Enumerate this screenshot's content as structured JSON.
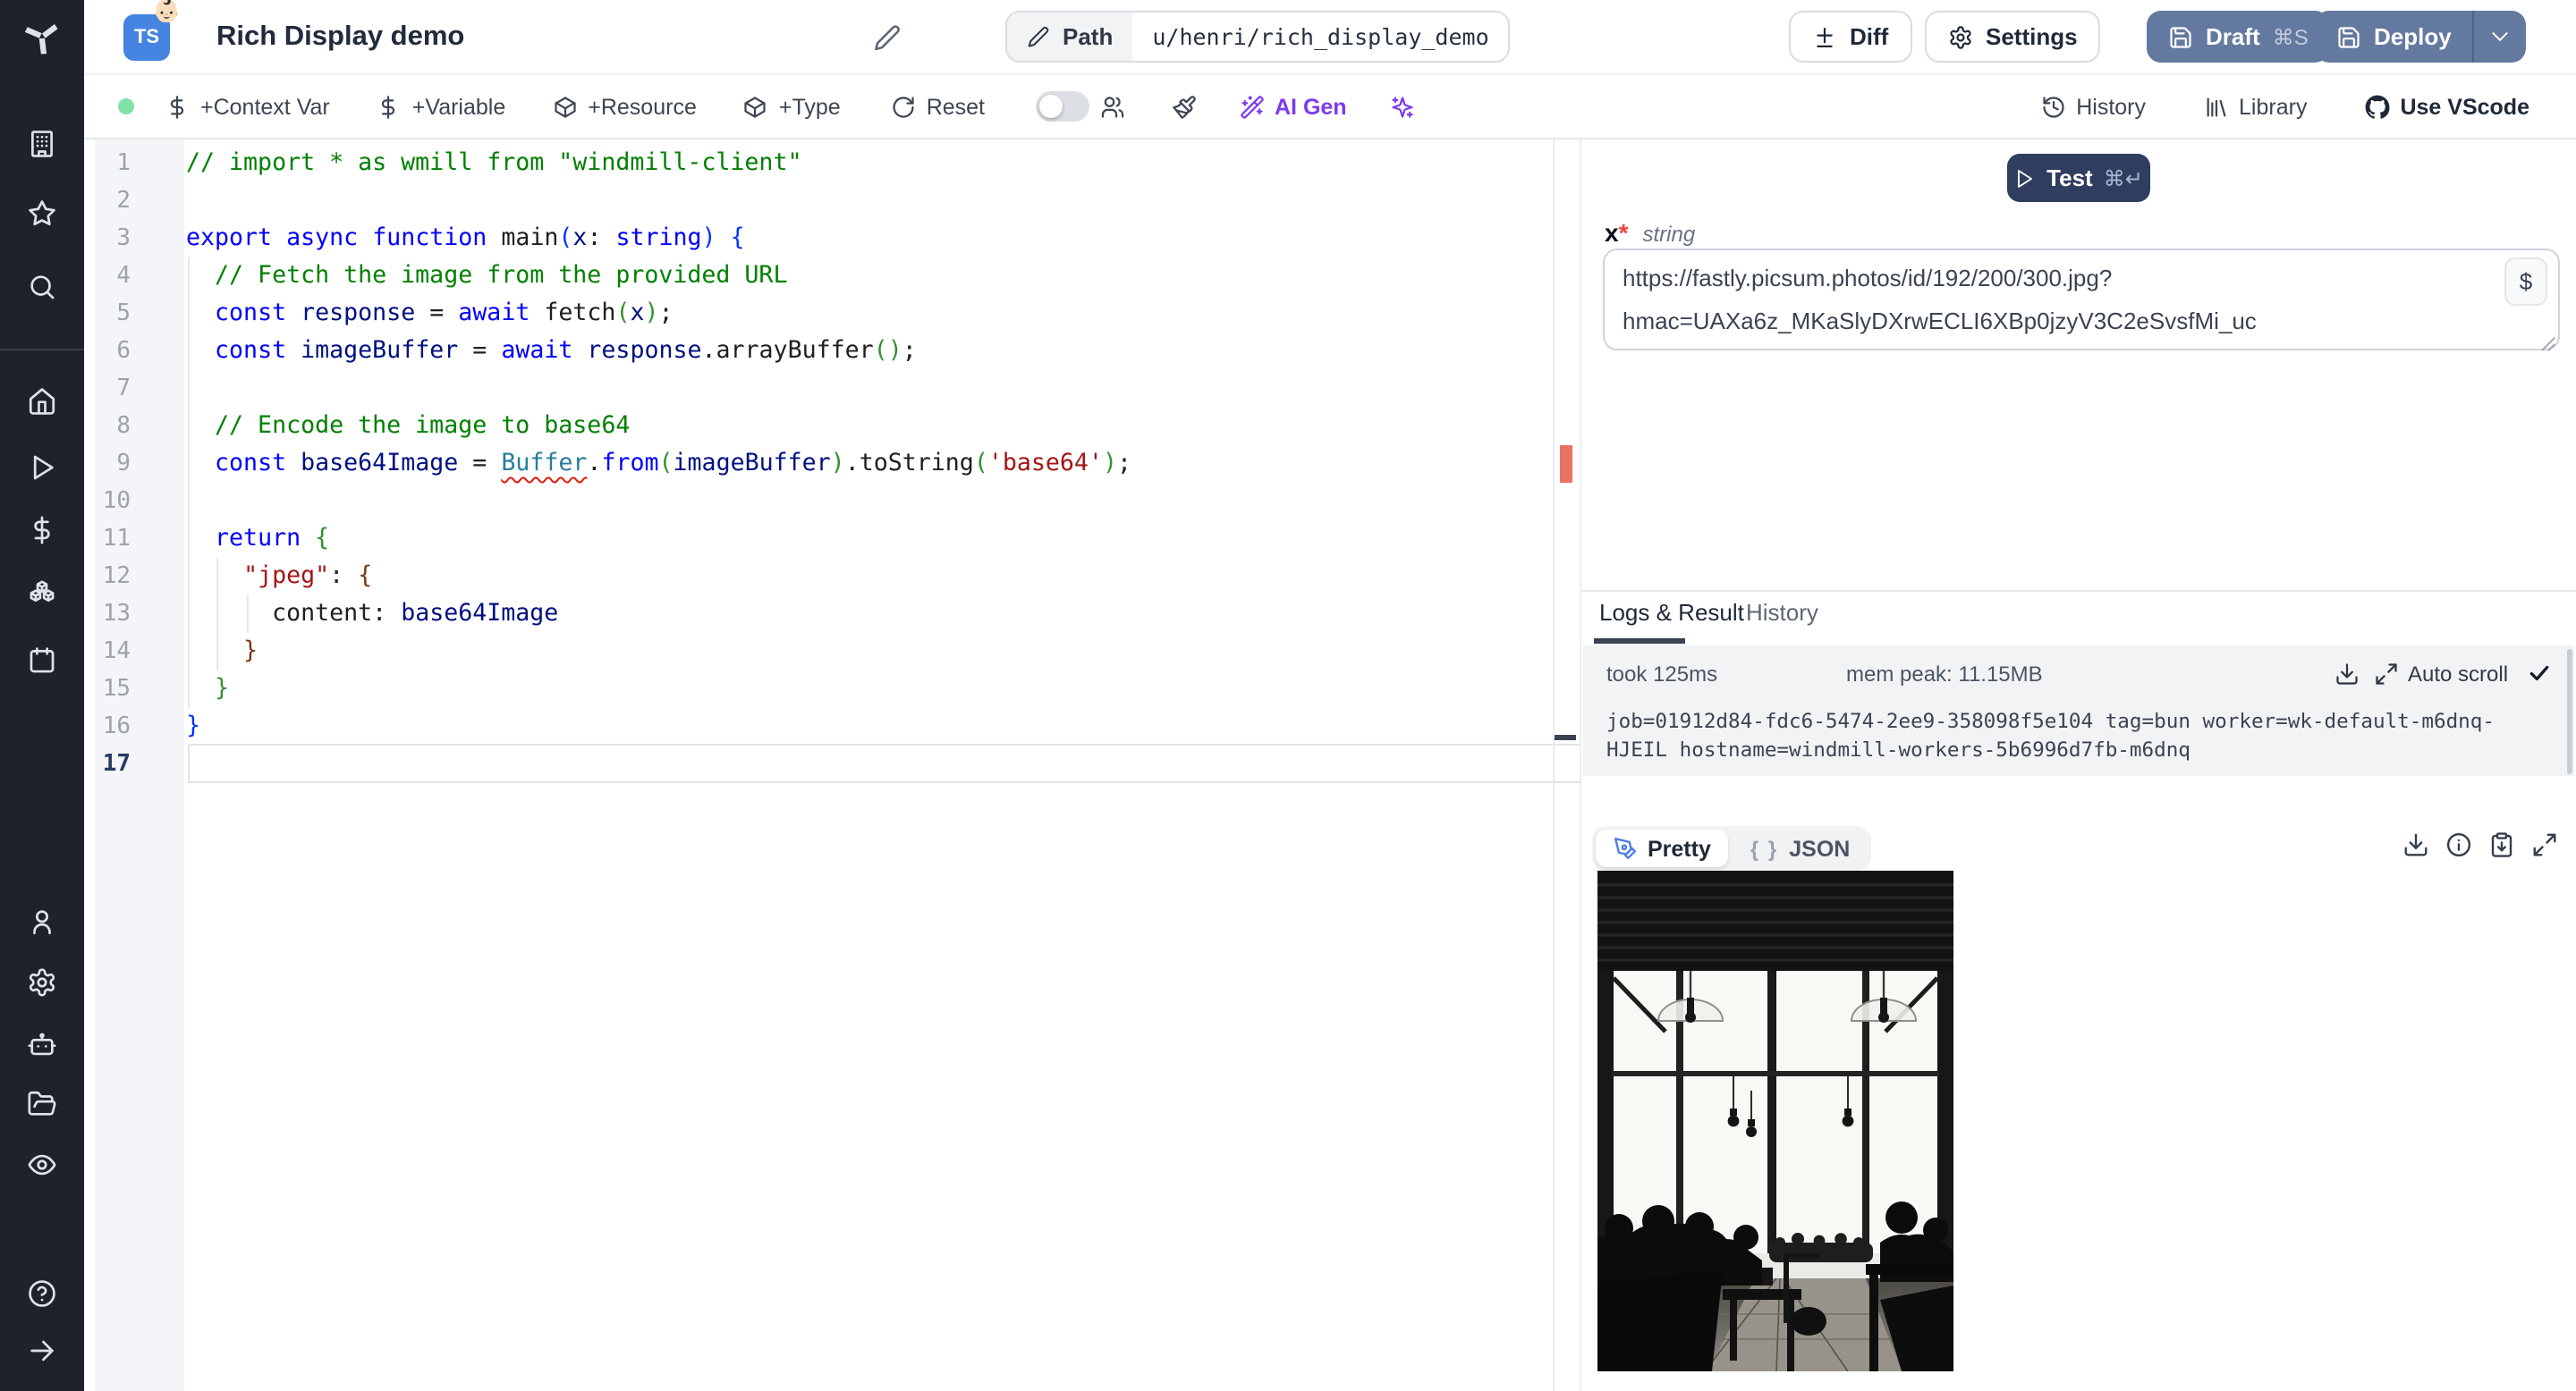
{
  "topbar": {
    "title": "Rich Display demo",
    "lang_badge": "TS",
    "badge_emoji": "👶🏻",
    "path_label": "Path",
    "path_value": "u/henri/rich_display_demo",
    "diff_label": "Diff",
    "settings_label": "Settings",
    "draft_label": "Draft",
    "draft_shortcut": "⌘S",
    "deploy_label": "Deploy"
  },
  "toolbar": {
    "context_var": "+Context Var",
    "variable": "+Variable",
    "resource": "+Resource",
    "type": "+Type",
    "reset": "Reset",
    "ai_gen": "AI Gen",
    "history": "History",
    "library": "Library",
    "vscode": "Use VScode"
  },
  "sidebar": {
    "top": [
      "building",
      "star",
      "search"
    ],
    "middle": [
      "home",
      "play",
      "dollar",
      "boxes",
      "calendar"
    ],
    "lower": [
      "user",
      "gear",
      "bot",
      "folder-open",
      "eye"
    ],
    "footer": [
      "help",
      "arrow-right"
    ]
  },
  "editor": {
    "colors": {
      "c": "#008000",
      "k": "#0000ff",
      "v": "#001080",
      "s": "#a31515",
      "ty": "#267f99",
      "b1": "#0431fa",
      "b2": "#319331",
      "b3": "#7b3814",
      "t": "#1f1f1f"
    },
    "lines": [
      {
        "n": 1,
        "tokens": [
          [
            "// import * as wmill from \"windmill-client\"",
            "c"
          ]
        ]
      },
      {
        "n": 2,
        "tokens": []
      },
      {
        "n": 3,
        "tokens": [
          [
            "export ",
            "k"
          ],
          [
            "async ",
            "k"
          ],
          [
            "function ",
            "k"
          ],
          [
            "main",
            "t"
          ],
          [
            "(",
            "b1"
          ],
          [
            "x",
            "v"
          ],
          [
            ": ",
            "t"
          ],
          [
            "string",
            "k"
          ],
          [
            ") ",
            "b1"
          ],
          [
            "{",
            "b1"
          ]
        ]
      },
      {
        "n": 4,
        "tokens": [
          [
            "  // Fetch the image from the provided URL",
            "c"
          ]
        ]
      },
      {
        "n": 5,
        "tokens": [
          [
            "  ",
            "t"
          ],
          [
            "const ",
            "k"
          ],
          [
            "response",
            "v"
          ],
          [
            " = ",
            "t"
          ],
          [
            "await ",
            "k"
          ],
          [
            "fetch",
            "t"
          ],
          [
            "(",
            "b2"
          ],
          [
            "x",
            "v"
          ],
          [
            ")",
            "b2"
          ],
          [
            ";",
            "t"
          ]
        ]
      },
      {
        "n": 6,
        "tokens": [
          [
            "  ",
            "t"
          ],
          [
            "const ",
            "k"
          ],
          [
            "imageBuffer",
            "v"
          ],
          [
            " = ",
            "t"
          ],
          [
            "await ",
            "k"
          ],
          [
            "response",
            "v"
          ],
          [
            ".arrayBuffer",
            "t"
          ],
          [
            "(",
            "b2"
          ],
          [
            ")",
            "b2"
          ],
          [
            ";",
            "t"
          ]
        ]
      },
      {
        "n": 7,
        "tokens": []
      },
      {
        "n": 8,
        "tokens": [
          [
            "  // Encode the image to base64",
            "c"
          ]
        ]
      },
      {
        "n": 9,
        "tokens": [
          [
            "  ",
            "t"
          ],
          [
            "const ",
            "k"
          ],
          [
            "base64Image",
            "v"
          ],
          [
            " = ",
            "t"
          ],
          [
            "Buffer",
            "ty-err"
          ],
          [
            ".",
            "t"
          ],
          [
            "from",
            "k"
          ],
          [
            "(",
            "b2"
          ],
          [
            "imageBuffer",
            "v"
          ],
          [
            ")",
            "b2"
          ],
          [
            ".toString",
            "t"
          ],
          [
            "(",
            "b2"
          ],
          [
            "'base64'",
            "s"
          ],
          [
            ")",
            "b2"
          ],
          [
            ";",
            "t"
          ]
        ]
      },
      {
        "n": 10,
        "tokens": []
      },
      {
        "n": 11,
        "tokens": [
          [
            "  ",
            "t"
          ],
          [
            "return ",
            "k"
          ],
          [
            "{",
            "b2"
          ]
        ]
      },
      {
        "n": 12,
        "tokens": [
          [
            "    ",
            "t"
          ],
          [
            "\"jpeg\"",
            "s"
          ],
          [
            ": ",
            "t"
          ],
          [
            "{",
            "b3"
          ]
        ]
      },
      {
        "n": 13,
        "tokens": [
          [
            "      content: ",
            "t"
          ],
          [
            "base64Image",
            "v"
          ]
        ]
      },
      {
        "n": 14,
        "tokens": [
          [
            "    }",
            "b3"
          ]
        ]
      },
      {
        "n": 15,
        "tokens": [
          [
            "  }",
            "b2"
          ]
        ]
      },
      {
        "n": 16,
        "tokens": [
          [
            "}",
            "b1"
          ]
        ]
      },
      {
        "n": 17,
        "tokens": [],
        "current": true
      }
    ]
  },
  "runner": {
    "test_label": "Test",
    "test_shortcut": "⌘↵",
    "arg_name": "x",
    "required_mark": "*",
    "arg_type": "string",
    "arg_value": "https://fastly.picsum.photos/id/192/200/300.jpg?hmac=UAXa6z_MKaSlyDXrwECLI6XBp0jzyV3C2eSvsfMi_uc",
    "arg_value_lines": [
      "https://fastly.picsum.photos/id/192/200/300.jpg?",
      "hmac=UAXa6z_MKaSlyDXrwECLI6XBp0jzyV3C2eSvsfMi_uc"
    ],
    "dollar": "$"
  },
  "logs": {
    "tab_active": "Logs & Result",
    "tab_history": "History",
    "took": "took 125ms",
    "mem": "mem peak: 11.15MB",
    "autoscroll": "Auto scroll",
    "lines": [
      "job=01912d84-fdc6-5474-2ee9-358098f5e104 tag=bun worker=wk-default-m6dnq-",
      "HJEIL hostname=windmill-workers-5b6996d7fb-m6dnq"
    ]
  },
  "result": {
    "pretty": "Pretty",
    "json": "JSON",
    "braces": "{ }"
  },
  "colors": {
    "accent_blue": "#64799f",
    "test_navy": "#2f3e5f",
    "purple": "#7c3aed",
    "green_dot": "#7ee2a8",
    "error_red": "#ea7265"
  }
}
